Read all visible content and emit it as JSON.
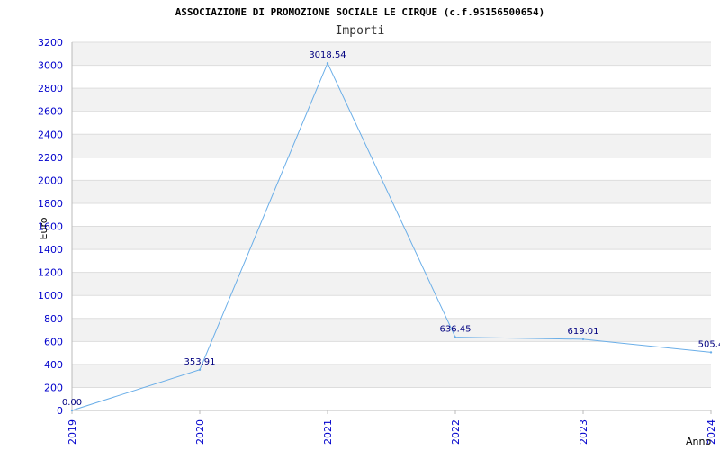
{
  "chart_data": {
    "type": "line",
    "title": "ASSOCIAZIONE DI PROMOZIONE SOCIALE LE CIRQUE (c.f.95156500654)",
    "subtitle": "Importi",
    "xlabel": "Anno",
    "ylabel": "Euro",
    "categories": [
      "2019",
      "2020",
      "2021",
      "2022",
      "2023",
      "2024"
    ],
    "values": [
      0.0,
      353.91,
      3018.54,
      636.45,
      619.01,
      505.4
    ],
    "data_labels": [
      "0.00",
      "353.91",
      "3018.54",
      "636.45",
      "619.01",
      "505.4"
    ],
    "yticks": [
      "0",
      "200",
      "400",
      "600",
      "800",
      "1000",
      "1200",
      "1400",
      "1600",
      "1800",
      "2000",
      "2200",
      "2400",
      "2600",
      "2800",
      "3000",
      "3200"
    ],
    "ylim": [
      0,
      3200
    ],
    "grid": true,
    "band_colors": [
      "#f2f2f2",
      "#ffffff"
    ],
    "line_color": "#6aaee8"
  }
}
